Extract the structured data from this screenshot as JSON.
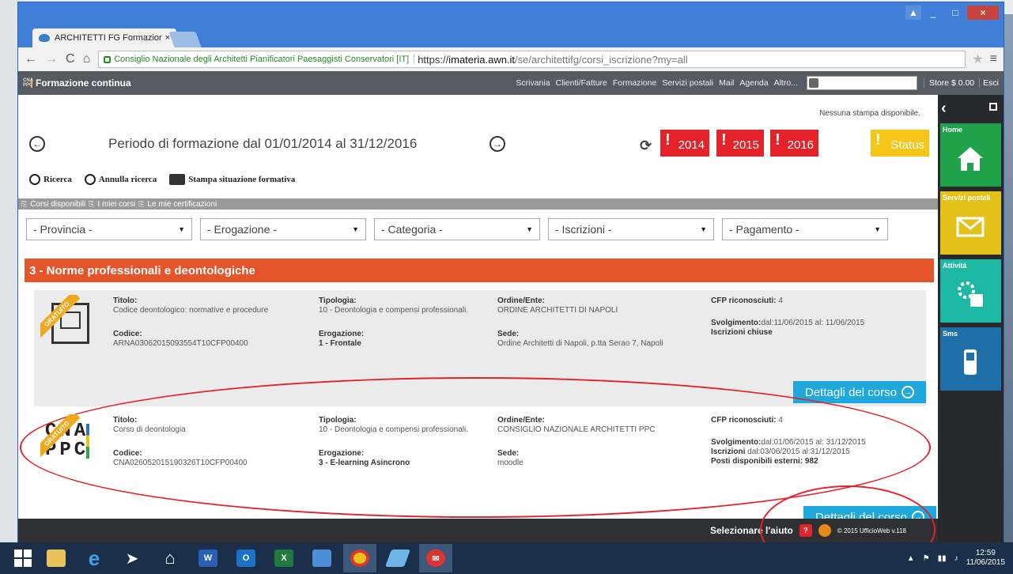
{
  "browser": {
    "tab_title": "ARCHITETTI FG Formazior",
    "tab_close": "×",
    "cert_label": "Consiglio Nazionale degli Architetti Pianificatori Paesaggisti Conservatori [IT]",
    "url_scheme": "https://",
    "url_host": "imateria.awn.it",
    "url_path": "/se/architettifg/corsi_iscrizione?my=all",
    "win_min": "_",
    "win_max": "□",
    "win_close": "×"
  },
  "topnav": {
    "brand": "Formazione continua",
    "brand_logo": "CNA PPC",
    "links": [
      "Scrivania",
      "Clienti/Fatture",
      "Formazione",
      "Servizi postali",
      "Mail",
      "Agenda",
      "Altro..."
    ],
    "store": "Store $ 0.00",
    "esci": "Esci"
  },
  "sidebar": {
    "tiles": [
      {
        "label": "Home",
        "icon": "house-icon",
        "color": "#1fa24a"
      },
      {
        "label": "Servizi postali",
        "icon": "envelope-icon",
        "color": "#e4c21a"
      },
      {
        "label": "Attività",
        "icon": "gears-icon",
        "color": "#1cb8a4"
      },
      {
        "label": "Sms",
        "icon": "phone-icon",
        "color": "#1e6fa8"
      }
    ]
  },
  "main": {
    "no_print": "Nessuna stampa disponibile.",
    "period_title": "Periodo di formazione dal 01/01/2014 al 31/12/2016",
    "years": [
      "2014",
      "2015",
      "2016"
    ],
    "status": "Status",
    "tools": {
      "search": "Ricerca",
      "cancel_search": "Annulla ricerca",
      "print": "Stampa situazione formativa"
    },
    "tabs": [
      "Corsi disponibili",
      "I miei corsi",
      "Le mie certificazioni"
    ],
    "filters": [
      "- Provincia -",
      "- Erogazione -",
      "- Categoria -",
      "- Iscrizioni -",
      "- Pagamento -"
    ],
    "category": "3 - Norme professionali e deontologiche",
    "details_label": "Dettagli del corso",
    "ribbon": "GRATUITO",
    "labels": {
      "titolo": "Titolo:",
      "codice": "Codice:",
      "tipologia": "Tipologia:",
      "erogazione": "Erogazione:",
      "ordine": "Ordine/Ente:",
      "sede": "Sede:",
      "cfp": "CFP riconosciuti:",
      "svolgimento": "Svolgimento:",
      "iscrizioni": "Iscrizioni",
      "posti": "Posti disponibili esterni:"
    },
    "courses": [
      {
        "titolo": "Codice deontologico: normative e procedure",
        "codice": "ARNA03062015093554T10CFP00400",
        "tipologia": "10 - Deontologia e compensi professionali.",
        "erogazione": "1 - Frontale",
        "ordine": "ORDINE ARCHITETTI DI NAPOLI",
        "sede": "Ordine Architetti di Napoli, p.tta Serao 7, Napoli",
        "cfp": "4",
        "svolgimento": "dal:11/06/2015 al: 11/06/2015",
        "iscrizioni": "Iscrizioni chiuse"
      },
      {
        "titolo": "Corso di deontologia",
        "codice": "CNA026052015190326T10CFP00400",
        "tipologia": "10 - Deontologia e compensi professionali.",
        "erogazione": "3 - E-learning Asincrono",
        "ordine": "CONSIGLIO NAZIONALE ARCHITETTI PPC",
        "sede": "moodle",
        "cfp": "4",
        "svolgimento": "dal:01/06/2015 al: 31/12/2015",
        "iscrizioni": "dal:03/06/2015 al:31/12/2015",
        "posti": "982",
        "logo": "CNA PPC"
      }
    ]
  },
  "footer": {
    "help": "Selezionare l'aiuto",
    "help_q": "?",
    "copyright": "© 2015 UfficioWeb v.118"
  },
  "taskbar": {
    "time": "12:59",
    "date": "11/06/2015"
  }
}
